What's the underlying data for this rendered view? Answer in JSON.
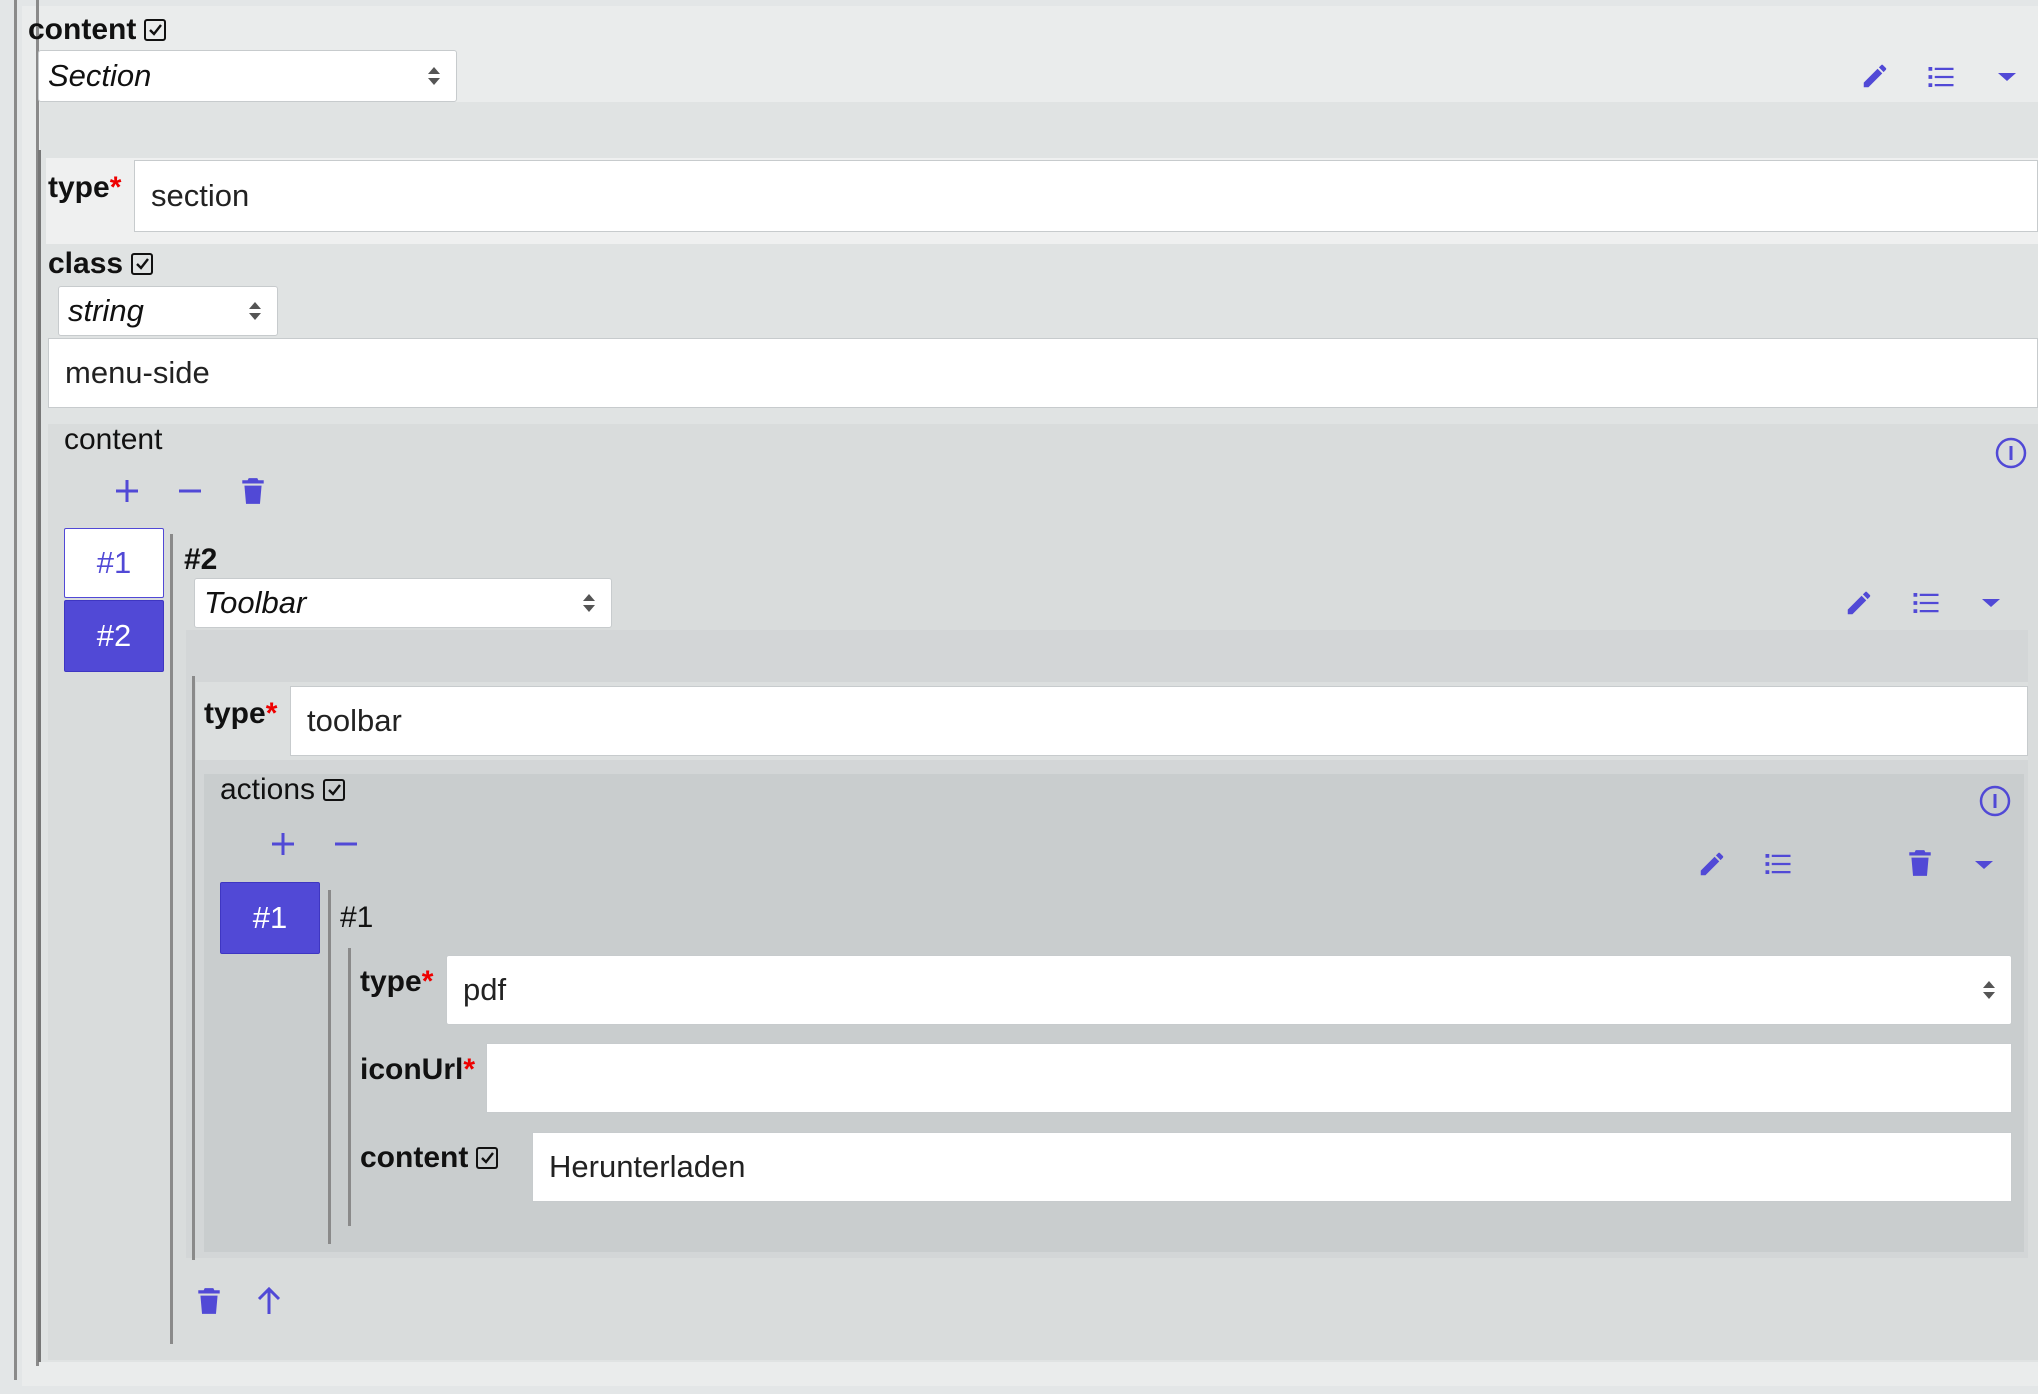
{
  "root": {
    "label": "content",
    "type_select": "Section",
    "type_field": {
      "label": "type",
      "value": "section"
    },
    "class": {
      "label": "class",
      "type_select": "string",
      "value": "menu-side"
    },
    "content_array": {
      "label": "content",
      "tabs": [
        "#1",
        "#2"
      ],
      "selected_tab": "#2",
      "item": {
        "label": "#2",
        "type_select": "Toolbar",
        "type_field": {
          "label": "type",
          "value": "toolbar"
        },
        "actions": {
          "label": "actions",
          "tabs": [
            "#1"
          ],
          "item": {
            "label": "#1",
            "type_field": {
              "label": "type",
              "value": "pdf"
            },
            "iconurl_field": {
              "label": "iconUrl",
              "value": ""
            },
            "content_field": {
              "label": "content",
              "value": "Herunterladen"
            }
          }
        }
      }
    }
  },
  "required_marker": "*",
  "colors": {
    "accent": "#5149d6",
    "required": "#e00000"
  }
}
